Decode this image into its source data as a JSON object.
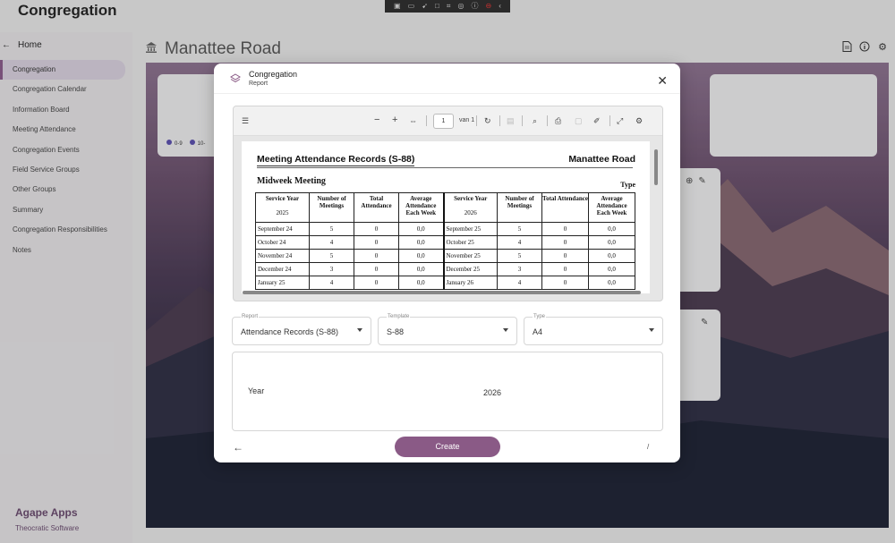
{
  "app": {
    "title": "Congregation"
  },
  "toolbar_strip": {
    "icons": [
      "screenshot-icon",
      "video-icon",
      "cursor-icon",
      "window-icon",
      "crop-icon",
      "share-icon",
      "info-icon",
      "stop-icon",
      "collapse-icon"
    ]
  },
  "sidebar": {
    "home_label": "Home",
    "items": [
      {
        "label": "Congregation",
        "active": true
      },
      {
        "label": "Congregation Calendar"
      },
      {
        "label": "Information Board"
      },
      {
        "label": "Meeting Attendance"
      },
      {
        "label": "Congregation Events"
      },
      {
        "label": "Field Service Groups"
      },
      {
        "label": "Other Groups"
      },
      {
        "label": "Summary"
      },
      {
        "label": "Congregation Responsibilities"
      },
      {
        "label": "Notes"
      }
    ],
    "brand": "Agape Apps",
    "brand_sub": "Theocratic Software"
  },
  "page": {
    "title": "Manattee Road"
  },
  "background": {
    "legend": [
      "0-9",
      "10-"
    ]
  },
  "modal": {
    "title": "Congregation",
    "subtitle": "Report",
    "viewer": {
      "page_number": "1",
      "page_count_label": "van 1",
      "document": {
        "title": "Meeting Attendance Records (S-88)",
        "congregation": "Manattee Road",
        "section": "Midweek Meeting",
        "type_label": "Type",
        "headers": {
          "service_year": "Service Year",
          "meetings": "Number of Meetings",
          "total": "Total Attendance",
          "average": "Average Attendance Each Week"
        },
        "year_left": "2025",
        "year_right": "2026",
        "rows": [
          {
            "m1": "September 24",
            "n1": "5",
            "t1": "0",
            "a1": "0,0",
            "m2": "September 25",
            "n2": "5",
            "t2": "0",
            "a2": "0,0"
          },
          {
            "m1": "October 24",
            "n1": "4",
            "t1": "0",
            "a1": "0,0",
            "m2": "October 25",
            "n2": "4",
            "t2": "0",
            "a2": "0,0"
          },
          {
            "m1": "November 24",
            "n1": "5",
            "t1": "0",
            "a1": "0,0",
            "m2": "November 25",
            "n2": "5",
            "t2": "0",
            "a2": "0,0"
          },
          {
            "m1": "December 24",
            "n1": "3",
            "t1": "0",
            "a1": "0,0",
            "m2": "December 25",
            "n2": "3",
            "t2": "0",
            "a2": "0,0"
          },
          {
            "m1": "January 25",
            "n1": "4",
            "t1": "0",
            "a1": "0,0",
            "m2": "January 26",
            "n2": "4",
            "t2": "0",
            "a2": "0,0"
          }
        ]
      }
    },
    "fields": {
      "report": {
        "label": "Report",
        "value": "Attendance Records (S-88)"
      },
      "template": {
        "label": "Template",
        "value": "S-88"
      },
      "type": {
        "label": "Type",
        "value": "A4"
      }
    },
    "params": {
      "year_label": "Year",
      "year_value": "2026"
    },
    "create_label": "Create",
    "slash": "/"
  }
}
